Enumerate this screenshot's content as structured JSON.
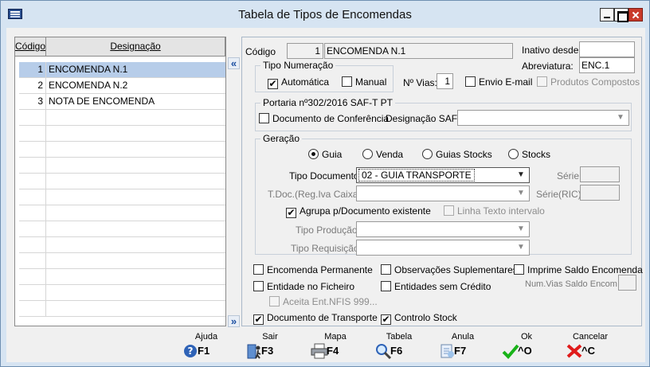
{
  "window": {
    "title": "Tabela de Tipos de Encomendas"
  },
  "grid": {
    "col_codigo": "Código",
    "col_designacao": "Designação",
    "rows": [
      {
        "codigo": "1",
        "designacao": "ENCOMENDA N.1"
      },
      {
        "codigo": "2",
        "designacao": "ENCOMENDA N.2"
      },
      {
        "codigo": "3",
        "designacao": "NOTA DE ENCOMENDA"
      }
    ],
    "arrow_top": "«",
    "arrow_bottom": "»"
  },
  "form": {
    "codigo_label": "Código",
    "codigo_value": "1",
    "designacao_value": "ENCOMENDA N.1",
    "inativo_label": "Inativo desde",
    "inativo_value": "",
    "abreviatura_label": "Abreviatura:",
    "abreviatura_value": "ENC.1",
    "tipo_numeracao_title": "Tipo Numeração",
    "automatica_label": "Automática",
    "manual_label": "Manual",
    "nvias_label": "Nº Vias:",
    "nvias_value": "1",
    "envio_email_label": "Envio E-mail",
    "produtos_compostos_label": "Produtos Compostos",
    "portaria_title": "Portaria nº302/2016 SAF-T PT",
    "doc_conferencia_label": "Documento de Conferência",
    "designacao_saft_label": "Designação SAFT",
    "designacao_saft_value": "",
    "geracao_title": "Geração",
    "radio_guia": "Guia",
    "radio_venda": "Venda",
    "radio_guias_stocks": "Guias Stocks",
    "radio_stocks": "Stocks",
    "tipo_documento_label": "Tipo Documento",
    "tipo_documento_value": "02 - GUIA TRANSPORTE",
    "serie_label": "Série",
    "tdoc_label": "T.Doc.(Reg.Iva Caixa)",
    "serie_ric_label": "Série(RIC)",
    "agrupa_label": "Agrupa p/Documento existente",
    "linha_texto_label": "Linha Texto intervalo",
    "tipo_producao_label": "Tipo Produção",
    "tipo_requisicao_label": "Tipo Requisição",
    "encomenda_permanente_label": "Encomenda Permanente",
    "observacoes_label": "Observações Suplementares",
    "imprime_saldo_label": "Imprime Saldo Encomenda",
    "entidade_ficheiro_label": "Entidade no Ficheiro",
    "entidades_credito_label": "Entidades sem Crédito",
    "num_vias_saldo_label": "Num.Vias Saldo Encom.",
    "aceita_label": "Aceita Ent.NFIS 999...",
    "doc_transporte_label": "Documento de Transporte",
    "controlo_stock_label": "Controlo Stock",
    "checkmark": "✔"
  },
  "toolbar": [
    {
      "label": "Ajuda",
      "key": "F1"
    },
    {
      "label": "Sair",
      "key": "F3"
    },
    {
      "label": "Mapa",
      "key": "F4"
    },
    {
      "label": "Tabela",
      "key": "F6"
    },
    {
      "label": "Anula",
      "key": "F7"
    },
    {
      "label": "Ok",
      "key": "^O"
    },
    {
      "label": "Cancelar",
      "key": "^C"
    }
  ]
}
